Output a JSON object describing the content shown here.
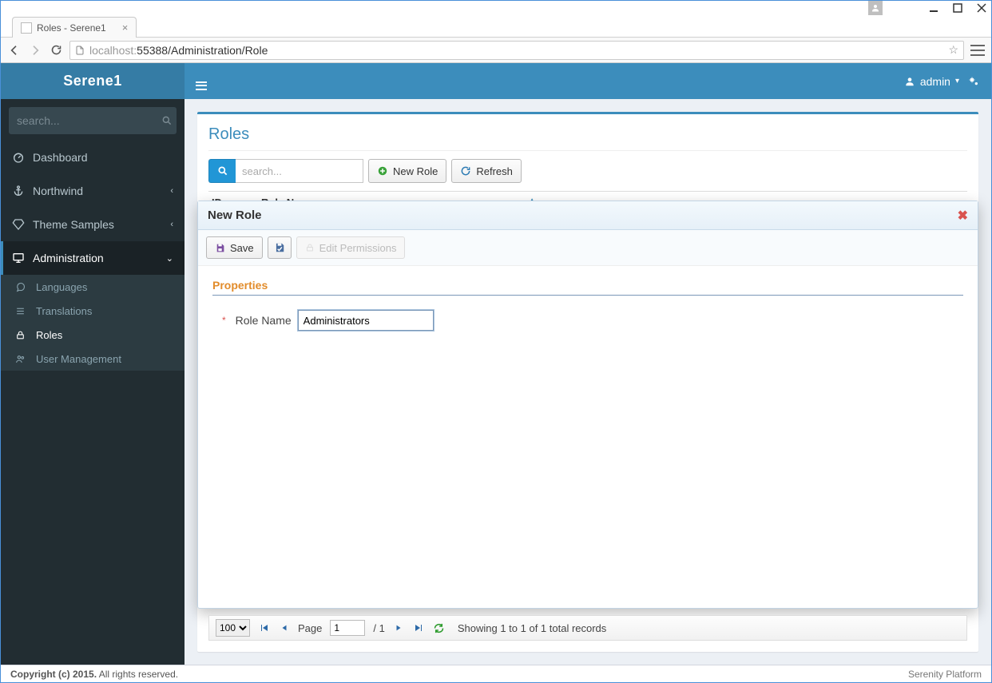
{
  "browser": {
    "tab_title": "Roles - Serene1",
    "url_host_muted": "localhost:",
    "url_port_path": "55388/Administration/Role"
  },
  "brand": "Serene1",
  "header": {
    "username": "admin"
  },
  "sidebar": {
    "search_placeholder": "search...",
    "items": [
      {
        "icon": "dashboard-icon",
        "label": "Dashboard",
        "expandable": false
      },
      {
        "icon": "anchor-icon",
        "label": "Northwind",
        "expandable": true
      },
      {
        "icon": "diamond-icon",
        "label": "Theme Samples",
        "expandable": true
      },
      {
        "icon": "desktop-icon",
        "label": "Administration",
        "expandable": true,
        "active": true
      }
    ],
    "admin_children": [
      {
        "icon": "chat-icon",
        "label": "Languages"
      },
      {
        "icon": "list-icon",
        "label": "Translations"
      },
      {
        "icon": "lock-icon",
        "label": "Roles",
        "active": true
      },
      {
        "icon": "users-icon",
        "label": "User Management"
      }
    ]
  },
  "page": {
    "title": "Roles",
    "search_placeholder": "search...",
    "new_button": "New Role",
    "refresh_button": "Refresh",
    "columns": {
      "id": "ID",
      "name": "Role Name"
    }
  },
  "dialog": {
    "title": "New Role",
    "save": "Save",
    "edit_permissions": "Edit Permissions",
    "properties": "Properties",
    "role_name_label": "Role Name",
    "role_name_value": "Administrators"
  },
  "pager": {
    "page_size": "100",
    "page_label": "Page",
    "page_value": "1",
    "page_total": "/ 1",
    "summary": "Showing 1 to 1 of 1 total records"
  },
  "footer": {
    "copyright_bold": "Copyright (c) 2015.",
    "copyright_rest": " All rights reserved.",
    "platform": "Serenity Platform"
  }
}
